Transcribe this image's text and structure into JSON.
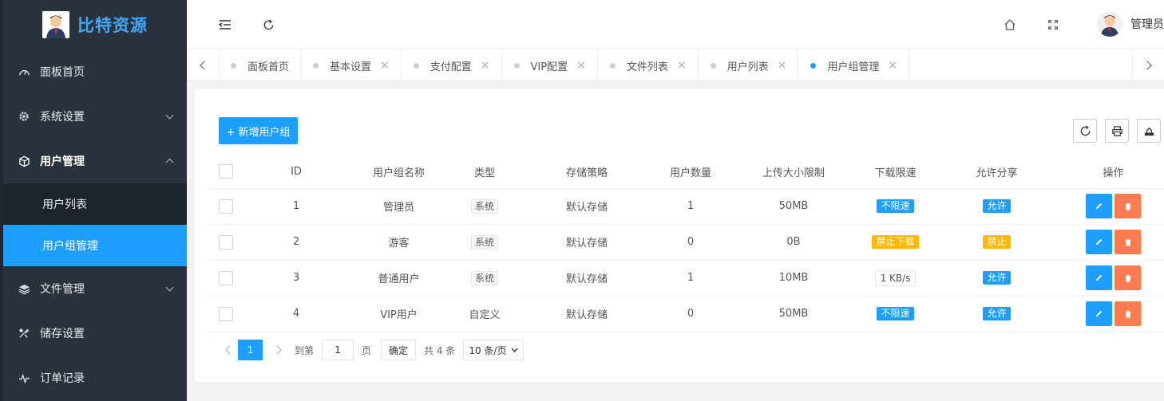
{
  "app": {
    "title": "比特资源"
  },
  "sidebar": {
    "items": [
      {
        "label": "面板首页",
        "icon": "dashboard-icon"
      },
      {
        "label": "系统设置",
        "icon": "gear-icon"
      },
      {
        "label": "用户管理",
        "icon": "cube-icon"
      },
      {
        "label": "文件管理",
        "icon": "layers-icon"
      },
      {
        "label": "储存设置",
        "icon": "tools-icon"
      },
      {
        "label": "订单记录",
        "icon": "pulse-icon"
      }
    ],
    "sub_items": [
      {
        "label": "用户列表"
      },
      {
        "label": "用户组管理"
      }
    ]
  },
  "header": {
    "user_name": "管理员"
  },
  "tabs": [
    {
      "label": "面板首页"
    },
    {
      "label": "基本设置"
    },
    {
      "label": "支付配置"
    },
    {
      "label": "VIP配置"
    },
    {
      "label": "文件列表"
    },
    {
      "label": "用户列表"
    },
    {
      "label": "用户组管理"
    }
  ],
  "toolbar": {
    "add_label": "+ 新增用户组"
  },
  "table": {
    "headers": [
      "ID",
      "用户组名称",
      "类型",
      "存储策略",
      "用户数量",
      "上传大小限制",
      "下载限速",
      "允许分享",
      "操作"
    ],
    "rows": [
      {
        "id": "1",
        "name": "管理员",
        "type": "系统",
        "storage": "默认存储",
        "count": "1",
        "upload": "50MB",
        "speed": "不限速",
        "share": "允许"
      },
      {
        "id": "2",
        "name": "游客",
        "type": "系统",
        "storage": "默认存储",
        "count": "0",
        "upload": "0B",
        "speed": "禁止下载",
        "share": "禁止"
      },
      {
        "id": "3",
        "name": "普通用户",
        "type": "系统",
        "storage": "默认存储",
        "count": "1",
        "upload": "10MB",
        "speed": "1 KB/s",
        "share": "允许"
      },
      {
        "id": "4",
        "name": "VIP用户",
        "type": "自定义",
        "storage": "默认存储",
        "count": "0",
        "upload": "50MB",
        "speed": "不限速",
        "share": "允许"
      }
    ]
  },
  "pager": {
    "current": "1",
    "goto_prefix": "到第",
    "goto_value": "1",
    "goto_suffix": "页",
    "ok": "确定",
    "total": "共 4 条",
    "page_size": "10 条/页"
  },
  "colors": {
    "primary": "#1e9fff",
    "warning": "#ffb800",
    "danger": "#ff5722",
    "sidebar": "#28333e"
  }
}
